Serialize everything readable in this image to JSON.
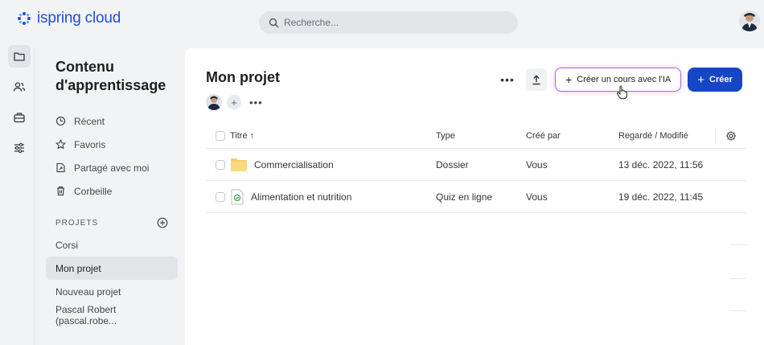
{
  "brand": {
    "name": "ispring cloud",
    "color": "#1f4fd6"
  },
  "search": {
    "placeholder": "Recherche..."
  },
  "rail": [
    {
      "icon": "folder-icon",
      "active": true
    },
    {
      "icon": "users-icon",
      "active": false
    },
    {
      "icon": "briefcase-icon",
      "active": false
    },
    {
      "icon": "sliders-icon",
      "active": false
    }
  ],
  "panel": {
    "title": "Contenu d'apprentissage",
    "nav": [
      {
        "icon": "clock-icon",
        "label": "Récent"
      },
      {
        "icon": "star-icon",
        "label": "Favoris"
      },
      {
        "icon": "shared-icon",
        "label": "Partagé avec moi"
      },
      {
        "icon": "trash-icon",
        "label": "Corbeille"
      }
    ],
    "projects_label": "PROJETS",
    "projects": [
      {
        "label": "Corsi",
        "active": false
      },
      {
        "label": "Mon projet",
        "active": true
      },
      {
        "label": "Nouveau projet",
        "active": false
      },
      {
        "label": "Pascal Robert (pascal.robe...",
        "active": false
      }
    ]
  },
  "main": {
    "title": "Mon projet",
    "more_label": "•••",
    "ai_button": "Créer un cours avec l'IA",
    "create_button": "Créer",
    "columns": {
      "title": "Titre ↑",
      "type": "Type",
      "author": "Créé par",
      "date": "Regardé / Modifié"
    },
    "rows": [
      {
        "icon": "folder-icon",
        "title": "Commercialisation",
        "type": "Dossier",
        "author": "Vous",
        "date": "13 déc. 2022, 11:56"
      },
      {
        "icon": "quiz-icon",
        "title": "Alimentation et nutrition",
        "type": "Quiz en ligne",
        "author": "Vous",
        "date": "19 déc. 2022, 11:45"
      }
    ]
  },
  "colors": {
    "accent": "#1646c8",
    "ai_border": "#a06bf0",
    "folder": "#f7cf6a"
  }
}
